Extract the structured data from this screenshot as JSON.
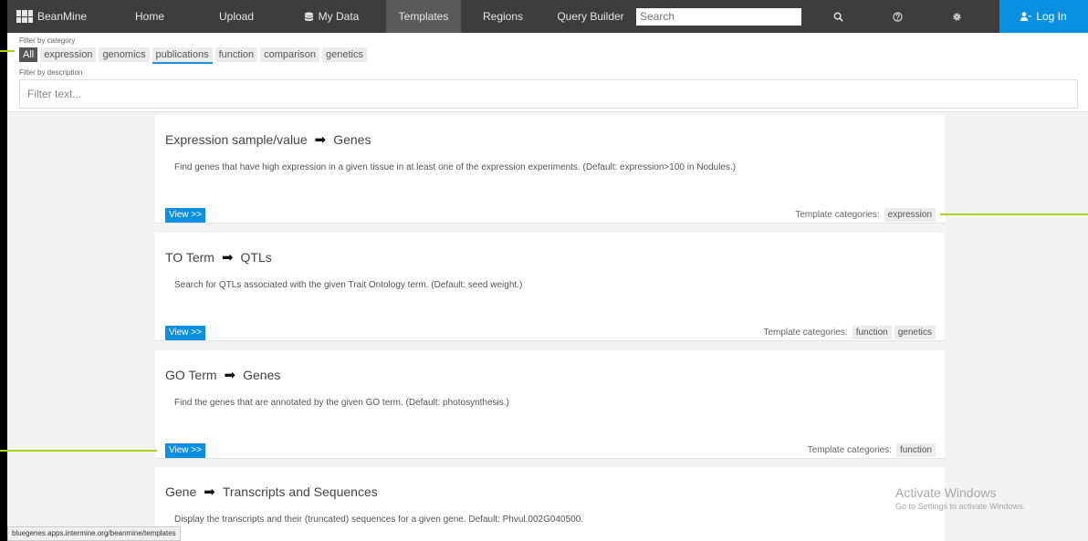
{
  "nav": {
    "brand": "BeanMine",
    "items": [
      "Home",
      "Upload",
      "My Data",
      "Templates",
      "Regions",
      "Query Builder"
    ],
    "active": "Templates",
    "search_placeholder": "Search",
    "icons": [
      "search-icon",
      "help-icon",
      "gear-icon"
    ],
    "login": "Log In"
  },
  "filters": {
    "category_label": "Filter by category",
    "categories": [
      "All",
      "expression",
      "genomics",
      "publications",
      "function",
      "comparison",
      "genetics"
    ],
    "description_label": "Filter by description",
    "text_placeholder": "Filter text..."
  },
  "templates": [
    {
      "from": "Expression sample/value",
      "to": "Genes",
      "description": "Find genes that have high expression in a given tissue in at least one of the expression experiments. (Default: expression>100 in Nodules.)",
      "view": "View >>",
      "categories_label": "Template categories:",
      "categories": [
        "expression"
      ]
    },
    {
      "from": "TO Term",
      "to": "QTLs",
      "description": "Search for QTLs associated with the given Trait Ontology term. (Default: seed weight.)",
      "view": "View >>",
      "categories_label": "Template categories:",
      "categories": [
        "function",
        "genetics"
      ]
    },
    {
      "from": "GO Term",
      "to": "Genes",
      "description": "Find the genes that are annotated by the given GO term. (Default: photosynthesis.)",
      "view": "View >>",
      "categories_label": "Template categories:",
      "categories": [
        "function"
      ]
    },
    {
      "from": "Gene",
      "to": "Transcripts and Sequences",
      "description": "Display the transcripts and their (truncated) sequences for a given gene. Default: Phvul.002G040500."
    }
  ],
  "status_url": "bluegenes.apps.intermine.org/beanmine/templates",
  "watermark": {
    "line1": "Activate Windows",
    "line2": "Go to Settings to activate Windows."
  },
  "colors": {
    "nav_bg": "#3d3d3d",
    "accent_blue": "#0a90e0",
    "annotation_green": "#a8d21e"
  }
}
